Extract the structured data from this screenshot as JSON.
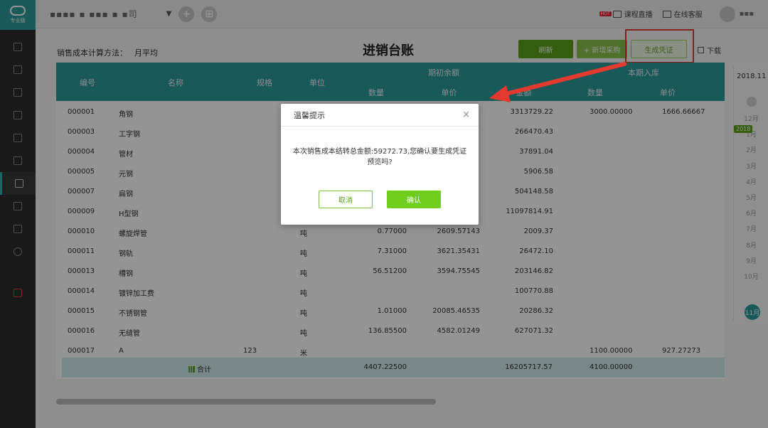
{
  "sidebar": {
    "brand": "专业版",
    "items": [
      "voucher-icon",
      "ledger-icon",
      "chart-icon",
      "report-icon",
      "invoice-icon",
      "calc-icon",
      "inventory-icon",
      "cash-icon",
      "settlement-icon",
      "settings-icon",
      "trash-icon"
    ]
  },
  "topbar": {
    "company": "▪▪▪▪ ▪ ▪▪▪ ▪ ▪司",
    "add_label": "+",
    "grid_label": "⊞",
    "live_hot": "HOT",
    "live_label": "课程直播",
    "service_label": "在线客服",
    "user_label": "▪▪▪"
  },
  "page": {
    "method_label": "销售成本计算方法：",
    "method_value": "月平均",
    "title": "进销台账",
    "btn_refresh": "刷新",
    "btn_add": "+ 新增采购",
    "btn_voucher": "生成凭证",
    "btn_download": "下载"
  },
  "table": {
    "headers": {
      "code": "编号",
      "name": "名称",
      "spec": "规格",
      "unit": "单位",
      "opening": "期初余额",
      "opening_qty": "数量",
      "opening_price": "单价",
      "opening_amount": "金额",
      "inbound": "本期入库",
      "inbound_qty": "数量",
      "inbound_price": "单价"
    },
    "rows": [
      {
        "code": "000001",
        "name": "角钢",
        "spec": "",
        "unit": "",
        "qty": "",
        "price": "",
        "amount": "3313729.22",
        "in_qty": "3000.00000",
        "in_price": "1666.66667"
      },
      {
        "code": "000003",
        "name": "工字钢",
        "spec": "",
        "unit": "",
        "qty": "",
        "price": "",
        "amount": "266470.43",
        "in_qty": "",
        "in_price": ""
      },
      {
        "code": "000004",
        "name": "管材",
        "spec": "",
        "unit": "",
        "qty": "",
        "price": "",
        "amount": "37891.04",
        "in_qty": "",
        "in_price": ""
      },
      {
        "code": "000005",
        "name": "元钢",
        "spec": "",
        "unit": "",
        "qty": "",
        "price": "",
        "amount": "5906.58",
        "in_qty": "",
        "in_price": ""
      },
      {
        "code": "000007",
        "name": "扁钢",
        "spec": "",
        "unit": "",
        "qty": "",
        "price": "",
        "amount": "504148.58",
        "in_qty": "",
        "in_price": ""
      },
      {
        "code": "000009",
        "name": "H型钢",
        "spec": "",
        "unit": "",
        "qty": "",
        "price": "",
        "amount": "11097814.91",
        "in_qty": "",
        "in_price": ""
      },
      {
        "code": "000010",
        "name": "螺旋焊管",
        "spec": "",
        "unit": "吨",
        "qty": "0.77000",
        "price": "2609.57143",
        "amount": "2009.37",
        "in_qty": "",
        "in_price": ""
      },
      {
        "code": "000011",
        "name": "钢轨",
        "spec": "",
        "unit": "吨",
        "qty": "7.31000",
        "price": "3621.35431",
        "amount": "26472.10",
        "in_qty": "",
        "in_price": ""
      },
      {
        "code": "000013",
        "name": "槽钢",
        "spec": "",
        "unit": "吨",
        "qty": "56.51200",
        "price": "3594.75545",
        "amount": "203146.82",
        "in_qty": "",
        "in_price": ""
      },
      {
        "code": "000014",
        "name": "镀锌加工费",
        "spec": "",
        "unit": "吨",
        "qty": "",
        "price": "",
        "amount": "100770.88",
        "in_qty": "",
        "in_price": ""
      },
      {
        "code": "000015",
        "name": "不锈钢管",
        "spec": "",
        "unit": "吨",
        "qty": "1.01000",
        "price": "20085.46535",
        "amount": "20286.32",
        "in_qty": "",
        "in_price": ""
      },
      {
        "code": "000016",
        "name": "无缝管",
        "spec": "",
        "unit": "吨",
        "qty": "136.85500",
        "price": "4582.01249",
        "amount": "627071.32",
        "in_qty": "",
        "in_price": ""
      },
      {
        "code": "000017",
        "name": "A",
        "spec": "123",
        "unit": "米",
        "qty": "",
        "price": "",
        "amount": "",
        "in_qty": "1100.00000",
        "in_price": "927.27273"
      }
    ],
    "total": {
      "label": "合计",
      "qty": "4407.22500",
      "amount": "16205717.57",
      "in_qty": "4100.00000"
    }
  },
  "timeline": {
    "year": "2018.11",
    "year_tag": "2018",
    "months": [
      "12月",
      "1月",
      "2月",
      "3月",
      "4月",
      "5月",
      "6月",
      "7月",
      "8月",
      "9月",
      "10月"
    ],
    "current": "11月"
  },
  "modal": {
    "title": "温馨提示",
    "close": "×",
    "message": "本次销售成本结转总金额:59272.73,您确认要生成凭证预览吗?",
    "cancel": "取消",
    "confirm": "确认"
  },
  "colors": {
    "accent": "#2d9a9b",
    "green": "#5aa317",
    "confirm": "#6fcd1c",
    "highlight": "#e53a2f"
  }
}
